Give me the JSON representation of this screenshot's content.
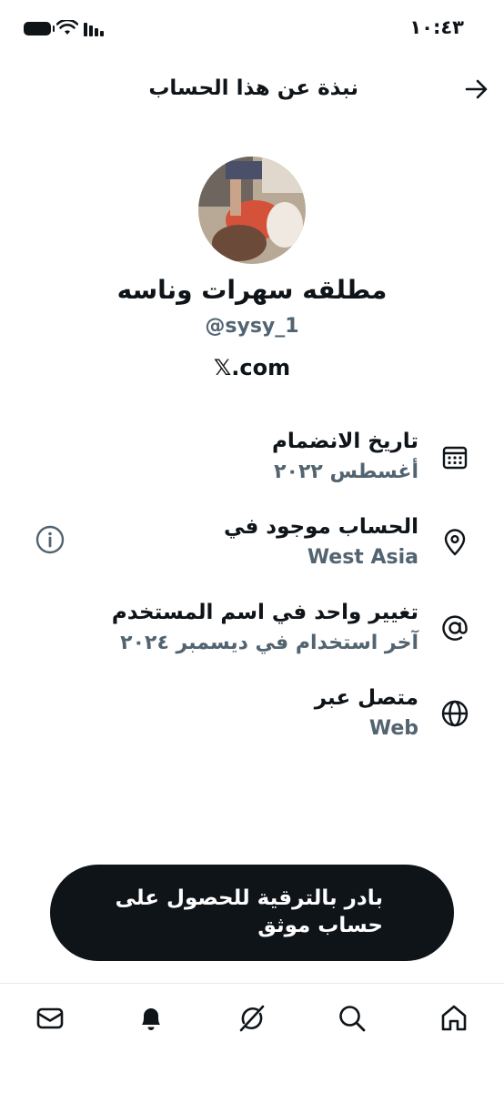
{
  "status_bar": {
    "time": "١٠:٤٣"
  },
  "header": {
    "title": "نبذة عن هذا الحساب"
  },
  "profile": {
    "display_name": "مطلقه سهرات وناسه",
    "handle": "@sysy_1",
    "site": "𝕏.com"
  },
  "details": [
    {
      "title": "تاريخ الانضمام",
      "value": "أغسطس ٢٠٢٢",
      "icon": "calendar-icon"
    },
    {
      "title": "الحساب موجود في",
      "value": "West Asia",
      "icon": "location-pin-icon"
    },
    {
      "title": "تغيير واحد في اسم المستخدم",
      "value": "آخر استخدام في ديسمبر ٢٠٢٤",
      "icon": "at-sign-icon"
    },
    {
      "title": "متصل عبر",
      "value": "Web",
      "icon": "globe-icon"
    }
  ],
  "cta": {
    "label": "بادر بالترقية للحصول على حساب موثق"
  },
  "bottom_nav": [
    {
      "name": "home",
      "icon": "home-icon"
    },
    {
      "name": "search",
      "icon": "search-icon"
    },
    {
      "name": "grok",
      "icon": "grok-icon"
    },
    {
      "name": "notifications",
      "icon": "bell-icon"
    },
    {
      "name": "messages",
      "icon": "mail-icon"
    }
  ],
  "colors": {
    "text": "#0f1419",
    "secondary": "#536471",
    "cta_bg": "#0f1419"
  }
}
